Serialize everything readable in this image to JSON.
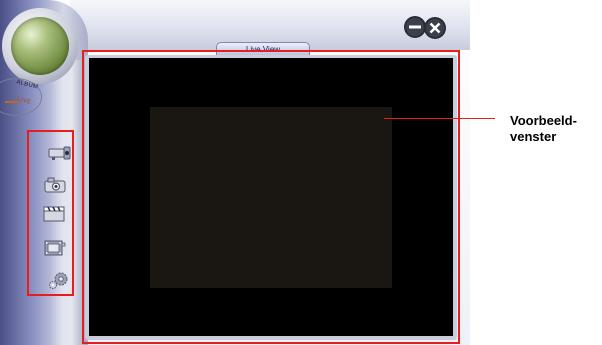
{
  "app": {
    "mode_selector": {
      "album_label": "ALBUM",
      "live_label": "LIVE"
    },
    "tab": {
      "label": "Live View"
    },
    "toolbar": {
      "tools": [
        {
          "name": "webcam-tool",
          "icon": "webcam-icon"
        },
        {
          "name": "snapshot-tool",
          "icon": "camera-icon"
        },
        {
          "name": "video-clip-tool",
          "icon": "clapperboard-icon"
        },
        {
          "name": "film-tool",
          "icon": "film-frame-icon"
        },
        {
          "name": "settings-tool",
          "icon": "gears-icon"
        }
      ]
    },
    "window_controls": {
      "minimize_icon": "minimize-icon",
      "close_icon": "close-icon"
    },
    "colors": {
      "highlight": "#e61e1e",
      "viewport": "#000000",
      "accent": "#6d8a3e"
    }
  },
  "annotation": {
    "label_line1": "Voorbeeld-",
    "label_line2": "venster"
  }
}
